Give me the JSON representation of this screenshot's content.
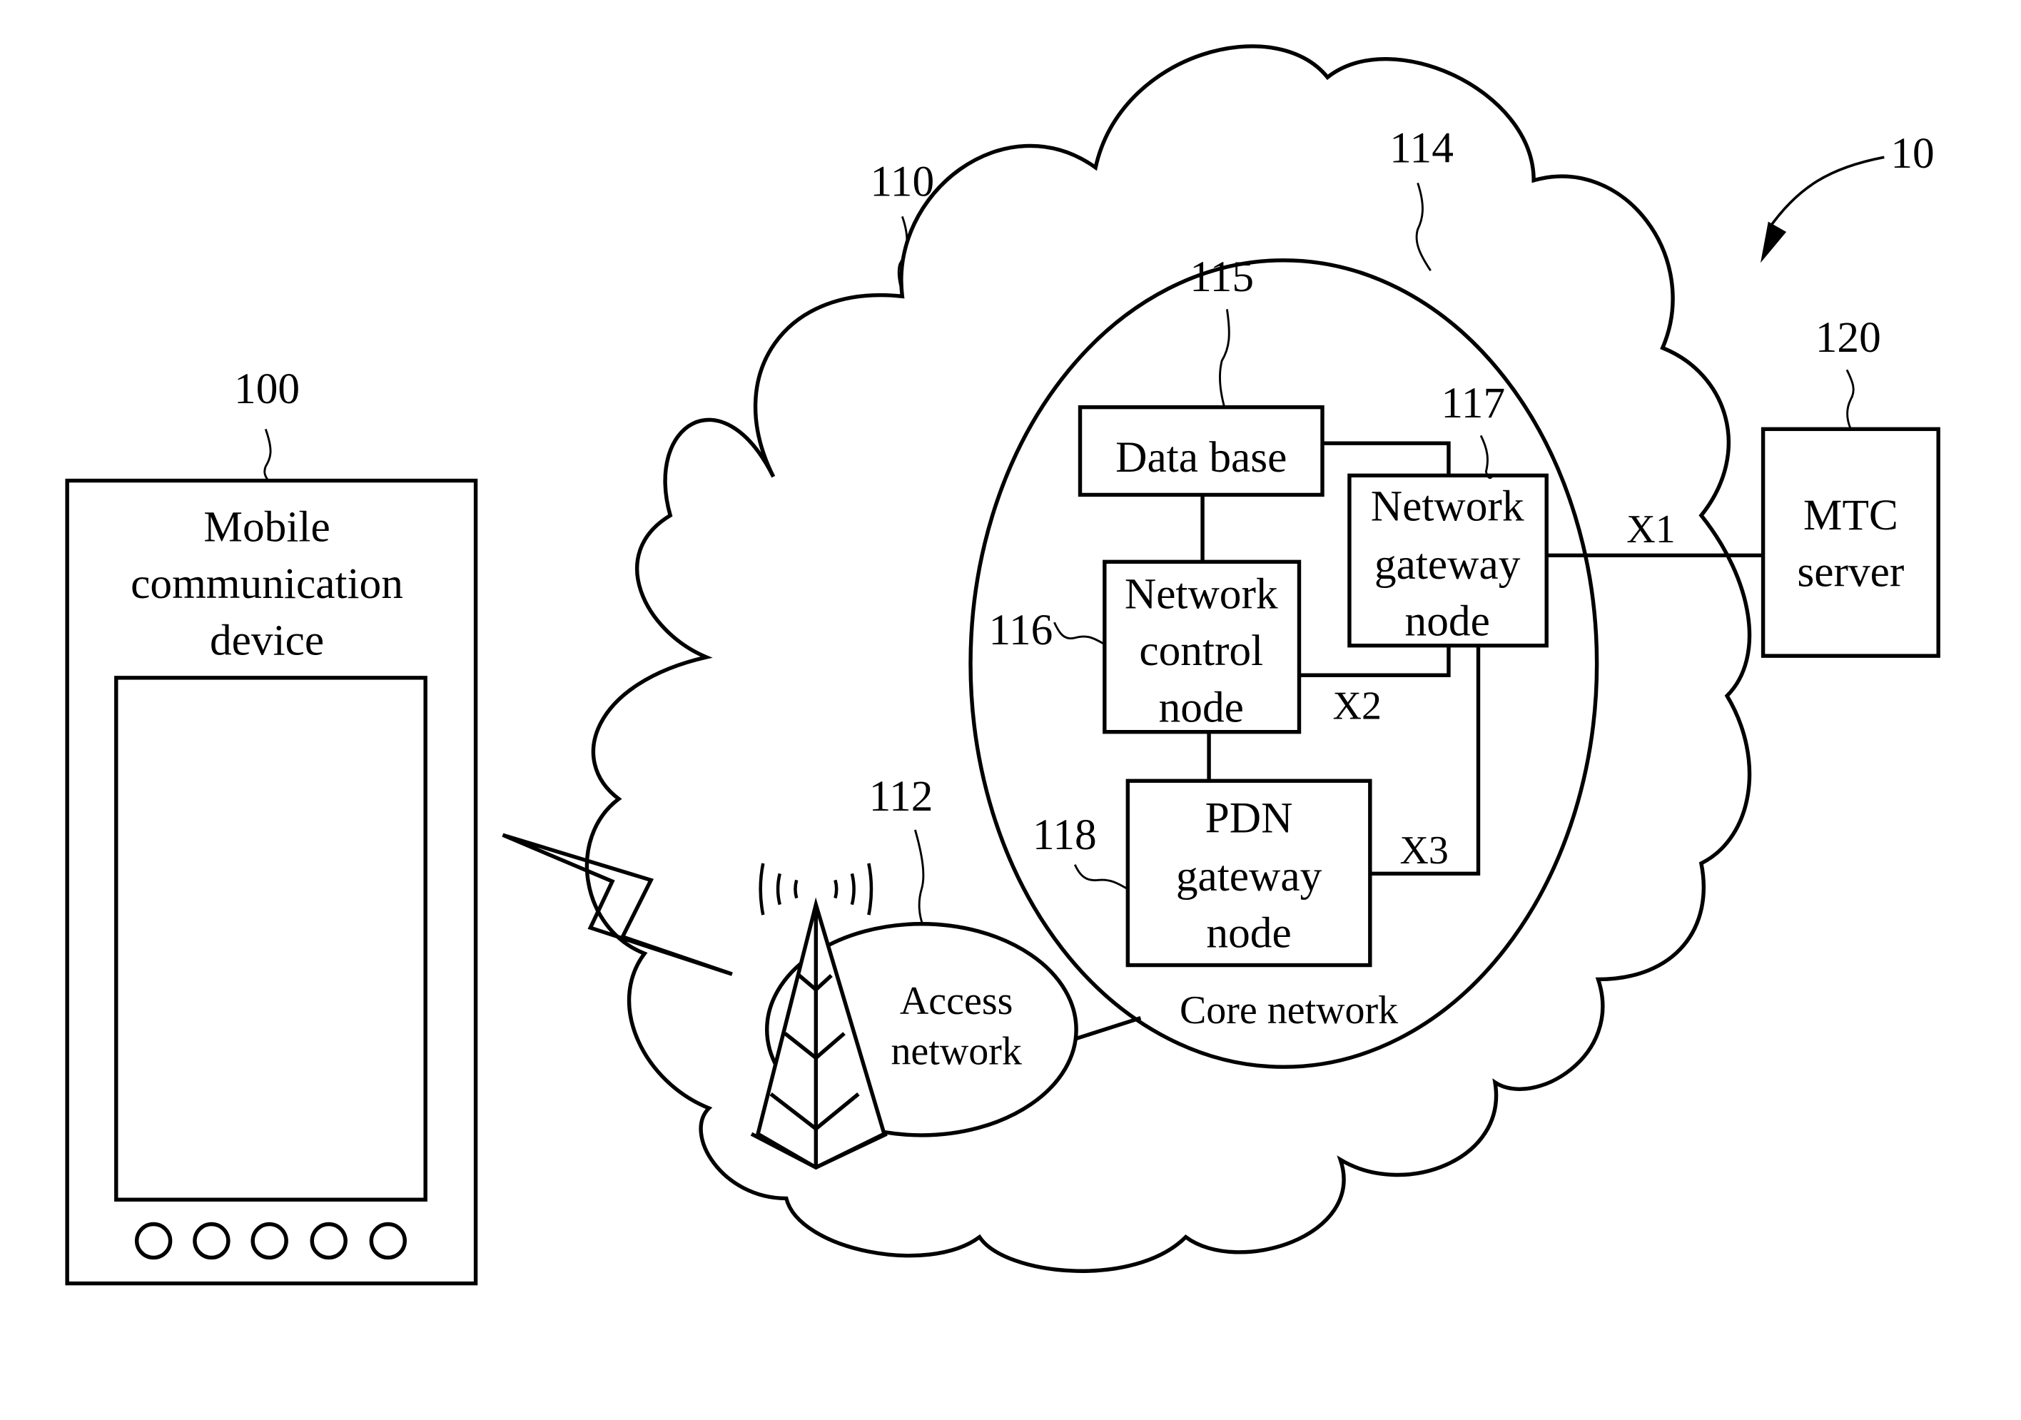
{
  "figure": {
    "system_ref": "10",
    "mobile_device": {
      "ref": "100",
      "label_lines": [
        "Mobile",
        "communication",
        "device"
      ],
      "button_count": 5
    },
    "network_cloud": {
      "ref": "110"
    },
    "access_network": {
      "ref": "112",
      "label_lines": [
        "Access",
        "network"
      ]
    },
    "core_network": {
      "ref": "114",
      "label": "Core network"
    },
    "database": {
      "ref": "115",
      "label": "Data base"
    },
    "network_control_node": {
      "ref": "116",
      "label_lines": [
        "Network",
        "control",
        "node"
      ]
    },
    "network_gateway_node": {
      "ref": "117",
      "label_lines": [
        "Network",
        "gateway",
        "node"
      ]
    },
    "pdn_gateway_node": {
      "ref": "118",
      "label_lines": [
        "PDN",
        "gateway",
        "node"
      ]
    },
    "mtc_server": {
      "ref": "120",
      "label_lines": [
        "MTC",
        "server"
      ]
    },
    "interfaces": {
      "x1": "X1",
      "x2": "X2",
      "x3": "X3"
    }
  }
}
